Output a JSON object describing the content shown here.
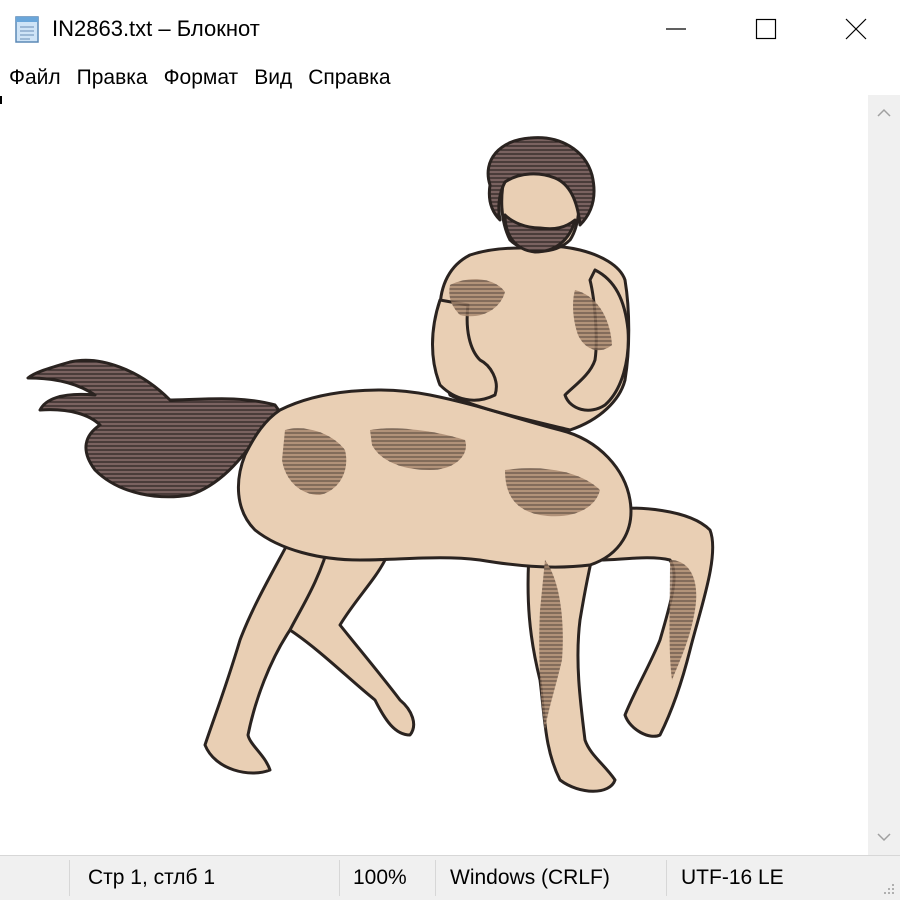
{
  "window": {
    "title": "IN2863.txt – Блокнот",
    "icons": {
      "app": "notepad-icon",
      "minimize": "minimize-icon",
      "maximize": "maximize-icon",
      "close": "close-icon"
    }
  },
  "menu": {
    "items": [
      "Файл",
      "Правка",
      "Формат",
      "Вид",
      "Справка"
    ]
  },
  "editor": {
    "content_description": "centaur-ascii-art",
    "colors": {
      "skin": "#e9cfb4",
      "shadow": "#a8886f",
      "hair": "#7a6260",
      "outline": "#2a2320"
    }
  },
  "scrollbar": {
    "up_icon": "scroll-up-arrow-icon",
    "down_icon": "scroll-down-arrow-icon"
  },
  "status": {
    "position": "Стр 1, стлб 1",
    "zoom": "100%",
    "line_endings": "Windows (CRLF)",
    "encoding": "UTF-16 LE"
  }
}
